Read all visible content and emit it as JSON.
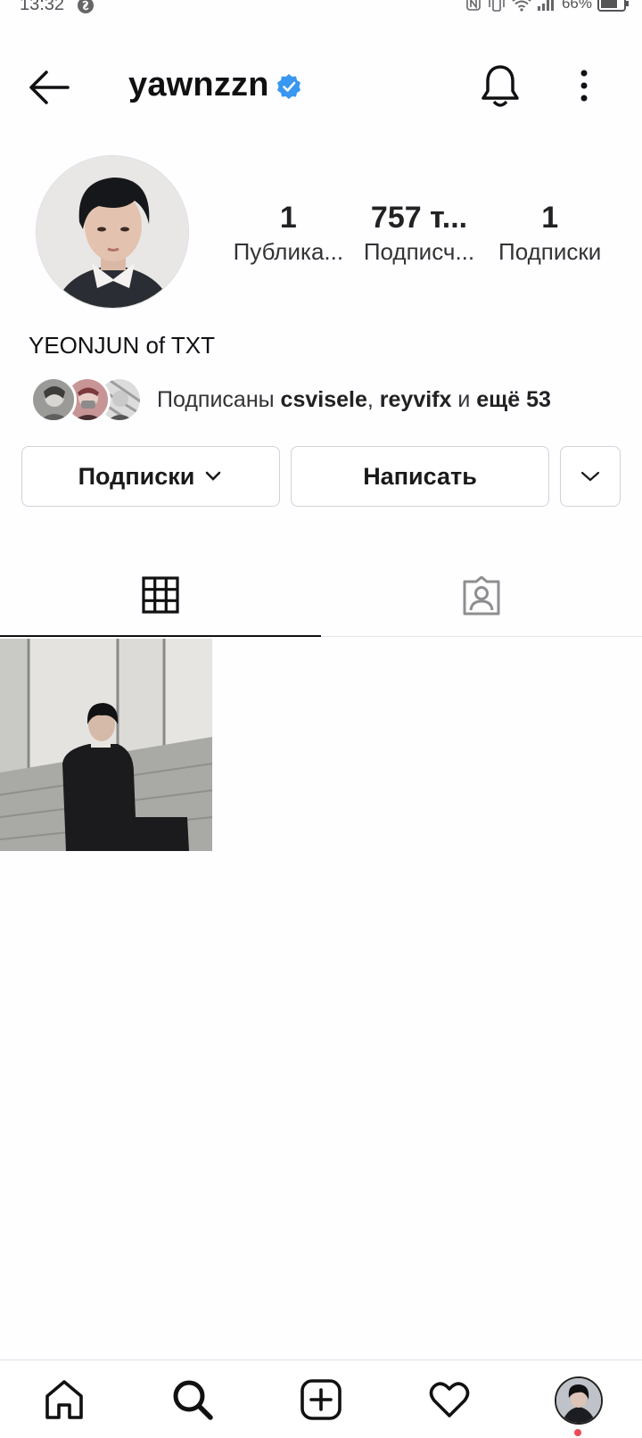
{
  "status_bar": {
    "time": "13:32",
    "battery": "66%"
  },
  "header": {
    "username": "yawnzzn"
  },
  "profile": {
    "stats": [
      {
        "value": "1",
        "label": "Публика..."
      },
      {
        "value": "757 т...",
        "label": "Подписч..."
      },
      {
        "value": "1",
        "label": "Подписки"
      }
    ],
    "display_name": "YEONJUN of TXT",
    "followed_by": {
      "prefix": "Подписаны ",
      "user1": "csvisele",
      "sep": ", ",
      "user2": "reyvifx",
      "conj": " и ",
      "more": "ещё 53"
    }
  },
  "actions": {
    "following_label": "Подписки",
    "message_label": "Написать"
  },
  "colors": {
    "verified": "#3897f0",
    "notification_dot": "#ed4956"
  }
}
